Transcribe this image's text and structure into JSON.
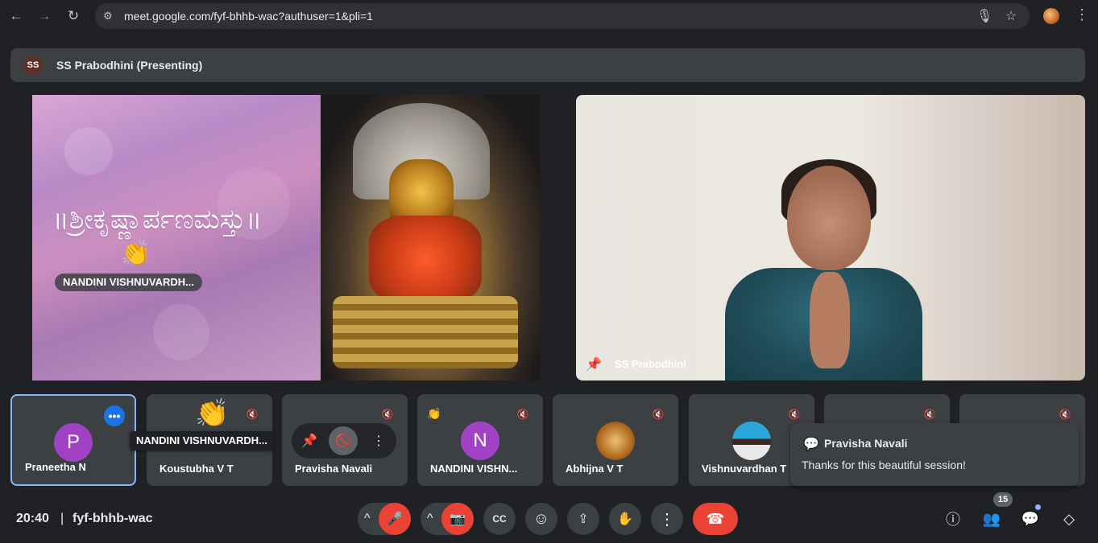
{
  "browser": {
    "url": "meet.google.com/fyf-bhhb-wac?authuser=1&pli=1",
    "back_icon": "←",
    "forward_icon": "→",
    "reload_icon": "↻",
    "tune_icon": "⚙",
    "mic_icon": "🎙",
    "star_icon": "☆",
    "menu_icon": "⋮"
  },
  "presenting_bar": {
    "initials": "SS",
    "title": "SS Prabodhini (Presenting)"
  },
  "presentation": {
    "kannada_text": "॥ಶ್ರೀಕೃಷ್ಣಾರ್ಪಣಮಸ್ತು॥",
    "reaction_emoji": "👏",
    "reaction_name": "NANDINI VISHNUVARDH..."
  },
  "self_view": {
    "name": "SS Prabodhini",
    "pin_icon": "📌"
  },
  "tiles": [
    {
      "name": "Praneetha N",
      "letter": "P",
      "color": "#a142c4"
    },
    {
      "name": "Koustubha V T",
      "emoji": "👏"
    },
    {
      "name": "Pravisha Navali"
    },
    {
      "name": "NANDINI VISHN...",
      "letter": "N",
      "color": "#a142c4",
      "emoji": "👏"
    },
    {
      "name": "Abhijna V T"
    },
    {
      "name": "Vishnuvardhan T"
    }
  ],
  "tooltip": "NANDINI VISHNUVARDH...",
  "hover_bar": {
    "pin": "📌",
    "mute": "🚫",
    "more": "⋮"
  },
  "toast": {
    "icon": "💬",
    "name": "Pravisha Navali",
    "message": "Thanks for this beautiful session!"
  },
  "footer": {
    "time": "20:40",
    "separator": "|",
    "meeting_code": "fyf-bhhb-wac",
    "people_count": "15"
  },
  "controls": {
    "chevron": "^",
    "mic_off": "🎤",
    "cam_off": "📷",
    "captions": "CC",
    "emoji": "☺",
    "present": "⇪",
    "raise_hand": "✋",
    "more": "⋮",
    "hangup": "☎",
    "info": "ⓘ",
    "people": "👥",
    "chat": "💬",
    "activities": "◇"
  },
  "colors": {
    "background": "#202124",
    "surface": "#3c4043",
    "danger": "#ea4335",
    "accent": "#8ab4f8",
    "active_dot": "#1a73e8"
  }
}
